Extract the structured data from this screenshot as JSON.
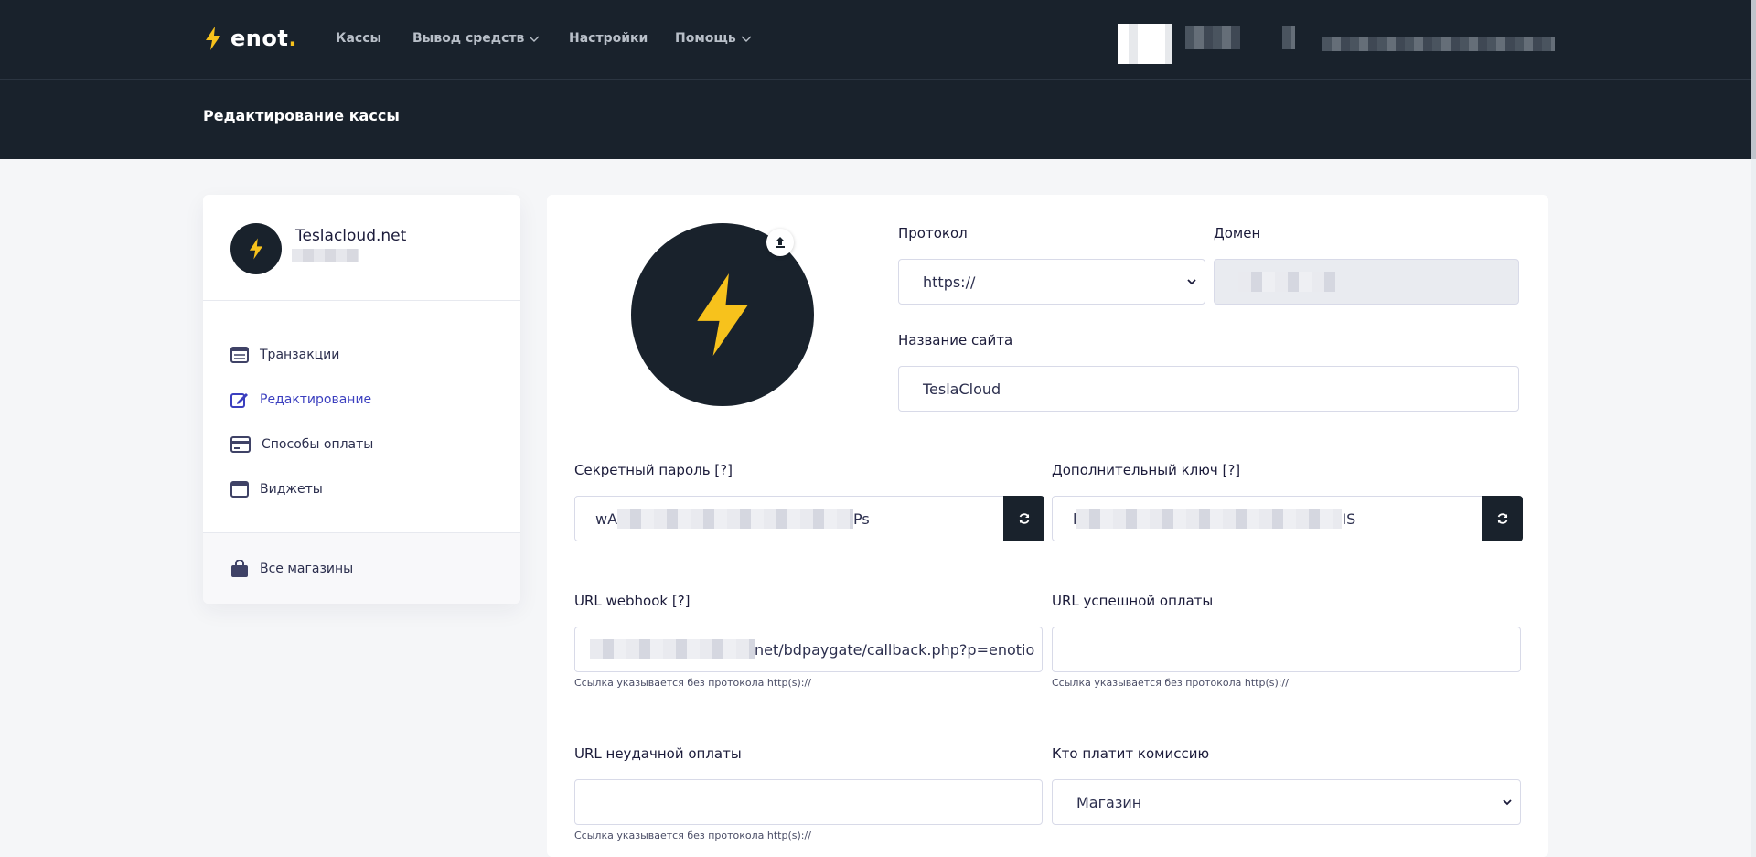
{
  "header": {
    "logo_text": "enot",
    "logo_dot": ".",
    "nav": [
      {
        "label": "Кассы"
      },
      {
        "label": "Вывод средств"
      },
      {
        "label": "Настройки"
      },
      {
        "label": "Помощь"
      }
    ],
    "page_title": "Редактирование кассы"
  },
  "sidebar": {
    "shop_name": "Teslacloud.net",
    "items": [
      {
        "label": "Транзакции",
        "icon": "transactions-icon"
      },
      {
        "label": "Редактирование",
        "icon": "edit-icon"
      },
      {
        "label": "Способы оплаты",
        "icon": "credit-card-icon"
      },
      {
        "label": "Виджеты",
        "icon": "widget-window-icon"
      }
    ],
    "footer_label": "Все магазины"
  },
  "form": {
    "protocol_label": "Протокол",
    "protocol_value": "https://",
    "domain_label": "Домен",
    "site_name_label": "Название сайта",
    "site_name_value": "TeslaCloud",
    "secret_label": "Секретный пароль [?]",
    "secret_prefix": "wA",
    "secret_suffix": "Ps",
    "extra_key_label": "Дополнительный ключ [?]",
    "extra_key_prefix": "l",
    "extra_key_suffix": "IS",
    "webhook_label": "URL webhook [?]",
    "webhook_value": "net/bdpaygate/callback.php?p=enotio",
    "webhook_hint": "Ссылка указывается без протокола http(s)://",
    "success_label": "URL успешной оплаты",
    "success_hint": "Ссылка указывается без протокола http(s)://",
    "fail_label": "URL неудачной оплаты",
    "fail_hint": "Ссылка указывается без протокола http(s)://",
    "commission_label": "Кто платит комиссию",
    "commission_value": "Магазин"
  },
  "colors": {
    "header_bg": "#19222c",
    "accent_yellow": "#f7c21c",
    "active_link": "#3b3fbf"
  }
}
